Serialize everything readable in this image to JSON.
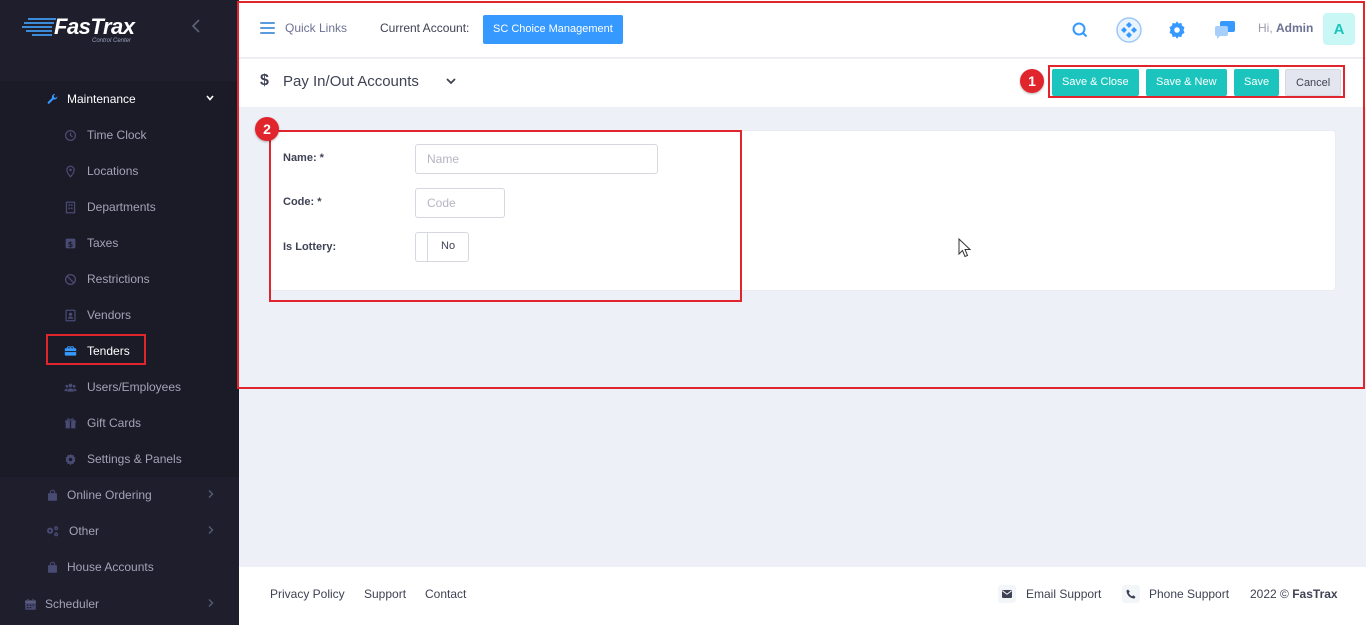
{
  "app": {
    "brand": "FasTrax",
    "brand_sub": "Control Center"
  },
  "sidebar": {
    "collapse_icon": "chevron-left-icon",
    "maintenance": {
      "label": "Maintenance",
      "icon": "wrench-icon"
    },
    "subitems": [
      {
        "label": "Time Clock",
        "icon": "clock-icon"
      },
      {
        "label": "Locations",
        "icon": "map-pin-icon"
      },
      {
        "label": "Departments",
        "icon": "building-icon"
      },
      {
        "label": "Taxes",
        "icon": "dollar-icon"
      },
      {
        "label": "Restrictions",
        "icon": "ban-icon"
      },
      {
        "label": "Vendors",
        "icon": "contact-icon"
      },
      {
        "label": "Tenders",
        "icon": "tender-icon"
      },
      {
        "label": "Users/Employees",
        "icon": "users-icon"
      },
      {
        "label": "Gift Cards",
        "icon": "gift-icon"
      },
      {
        "label": "Settings & Panels",
        "icon": "gear-icon"
      }
    ],
    "top_items": [
      {
        "label": "Online Ordering",
        "icon": "bag-icon"
      },
      {
        "label": "Other",
        "icon": "gears-icon"
      },
      {
        "label": "House Accounts",
        "icon": "bag-icon"
      }
    ],
    "scheduler": {
      "label": "Scheduler",
      "icon": "calendar-icon"
    }
  },
  "topbar": {
    "quick_links": "Quick Links",
    "account_label": "Current Account:",
    "account_value": "SC Choice Management",
    "greeting_prefix": "Hi,",
    "user_name": "Admin",
    "avatar_letter": "A"
  },
  "subheader": {
    "title": "Pay In/Out Accounts",
    "save_close": "Save & Close",
    "save_new": "Save & New",
    "save": "Save",
    "cancel": "Cancel"
  },
  "annotations": {
    "badge1": "1",
    "badge2": "2"
  },
  "form": {
    "name_label": "Name: *",
    "name_placeholder": "Name",
    "code_label": "Code: *",
    "code_placeholder": "Code",
    "lottery_label": "Is Lottery:",
    "lottery_value": "No"
  },
  "footer": {
    "privacy": "Privacy Policy",
    "support": "Support",
    "contact": "Contact",
    "email_support": "Email Support",
    "phone_support": "Phone Support",
    "copyright_prefix": "2022 ©",
    "copyright_brand": "FasTrax"
  },
  "colors": {
    "sidebar_bg": "#1e1e2d",
    "primary": "#3699ff",
    "success": "#1bc5bd",
    "highlight": "#e0262c"
  }
}
